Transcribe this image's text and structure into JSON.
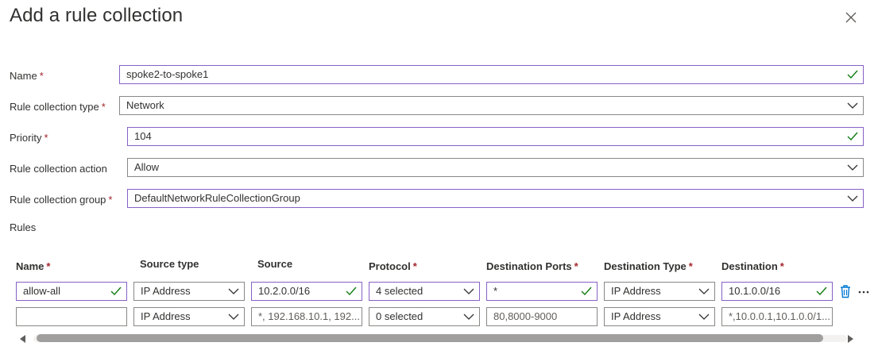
{
  "header": {
    "title": "Add a rule collection"
  },
  "form": {
    "name": {
      "label": "Name",
      "required": true,
      "value": "spoke2-to-spoke1",
      "valid": true
    },
    "type": {
      "label": "Rule collection type",
      "required": true,
      "value": "Network"
    },
    "priority": {
      "label": "Priority",
      "required": true,
      "value": "104",
      "valid": true
    },
    "action": {
      "label": "Rule collection action",
      "required": false,
      "value": "Allow"
    },
    "group": {
      "label": "Rule collection group",
      "required": true,
      "value": "DefaultNetworkRuleCollectionGroup"
    }
  },
  "rules": {
    "label": "Rules",
    "columns": [
      {
        "label": "Name",
        "required": true
      },
      {
        "label": "Source type",
        "required": false
      },
      {
        "label": "Source",
        "required": false
      },
      {
        "label": "Protocol",
        "required": true
      },
      {
        "label": "Destination Ports",
        "required": true
      },
      {
        "label": "Destination Type",
        "required": true
      },
      {
        "label": "Destination",
        "required": true
      }
    ],
    "rows": [
      {
        "name": "allow-all",
        "source_type": "IP Address",
        "source": "10.2.0.0/16",
        "protocol": "4 selected",
        "destination_ports": "*",
        "destination_type": "IP Address",
        "destination": "10.1.0.0/16"
      },
      {
        "name": "",
        "source_type": "IP Address",
        "source_placeholder": "*, 192.168.10.1, 192...",
        "protocol": "0 selected",
        "destination_ports_placeholder": "80,8000-9000",
        "destination_type": "IP Address",
        "destination_placeholder": "*,10.0.0.1,10.1.0.0/1..."
      }
    ]
  },
  "icons": {
    "close": "close-icon",
    "check": "checkmark-icon",
    "chevron": "chevron-down-icon",
    "delete": "trash-icon",
    "more": "more-icon"
  },
  "colors": {
    "valid_border": "#8661c5",
    "check": "#107c10",
    "required": "#a4262c",
    "delete": "#0078d4"
  }
}
